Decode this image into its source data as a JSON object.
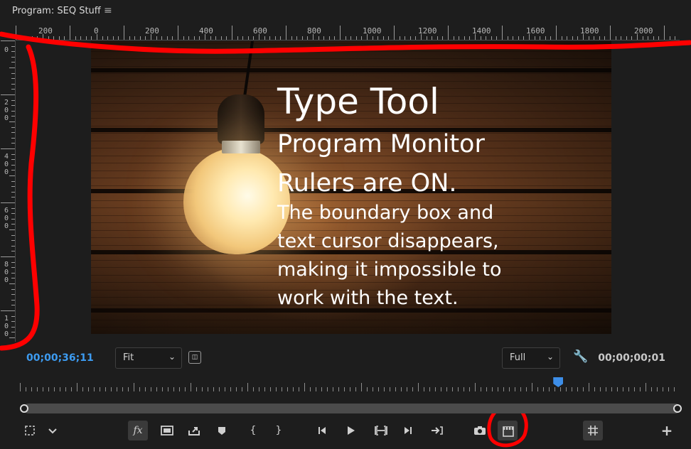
{
  "panel": {
    "title": "Program: SEQ Stuff",
    "menu_icon": "hamburger-menu-icon"
  },
  "ruler": {
    "horizontal_labels": [
      "200",
      "0",
      "200",
      "400",
      "600",
      "800",
      "1000",
      "1200",
      "1400",
      "1600",
      "1800",
      "2000"
    ],
    "vertical_labels": [
      "0",
      "200",
      "400",
      "600",
      "800",
      "100"
    ]
  },
  "caption": {
    "title": "Type Tool",
    "lines_large": [
      "Program Monitor",
      "Rulers are ON."
    ],
    "lines_small": [
      "The boundary box and",
      "text cursor disappears,",
      "making it impossible to",
      "work with the text."
    ]
  },
  "controls": {
    "timecode_current": "00;00;36;11",
    "zoom_value": "Fit",
    "quality_value": "Full",
    "timecode_duration": "00;00;00;01"
  },
  "playback": {
    "playhead_position": 0.816
  },
  "buttons": [
    {
      "name": "safe-margins-button",
      "icon": "dashed-square-icon"
    },
    {
      "name": "settings-dropdown-button",
      "icon": "chevron-down-icon"
    },
    {
      "name": "fx-button",
      "icon": "fx-icon"
    },
    {
      "name": "comparison-view-button",
      "icon": "rectangle-icon"
    },
    {
      "name": "export-frame-button",
      "icon": "export-icon"
    },
    {
      "name": "add-marker-button",
      "icon": "marker-icon"
    },
    {
      "name": "mark-in-button",
      "icon": "bracket-left-icon"
    },
    {
      "name": "mark-out-button",
      "icon": "bracket-right-icon"
    },
    {
      "name": "step-back-button",
      "icon": "step-back-icon"
    },
    {
      "name": "play-button",
      "icon": "play-icon"
    },
    {
      "name": "trim-button",
      "icon": "trim-icon"
    },
    {
      "name": "step-forward-button",
      "icon": "step-forward-icon"
    },
    {
      "name": "go-to-out-button",
      "icon": "go-to-out-icon"
    },
    {
      "name": "export-camera-button",
      "icon": "camera-icon"
    },
    {
      "name": "proxy-toggle-button",
      "icon": "clapper-icon"
    },
    {
      "name": "grid-button",
      "icon": "grid-icon"
    },
    {
      "name": "add-button",
      "icon": "plus-icon"
    }
  ],
  "annotation_color": "#ff0000",
  "accent_color": "#3d9bf0"
}
